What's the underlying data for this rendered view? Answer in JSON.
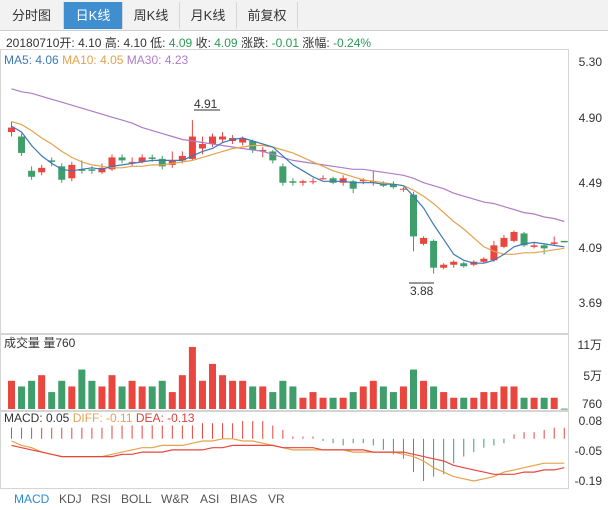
{
  "tabs": [
    {
      "label": "分时图",
      "active": false
    },
    {
      "label": "日K线",
      "active": true
    },
    {
      "label": "周K线",
      "active": false
    },
    {
      "label": "月K线",
      "active": false
    },
    {
      "label": "前复权",
      "active": false
    }
  ],
  "quote": {
    "date": "20180710",
    "open_label": "开:",
    "open": "4.10",
    "high_label": "高:",
    "high": "4.10",
    "low_label": "低:",
    "low": "4.09",
    "close_label": "收:",
    "close": "4.09",
    "change_label": "涨跌:",
    "change": "-0.01",
    "pct_label": "涨幅:",
    "pct": "-0.24%"
  },
  "ma": {
    "ma5_label": "MA5:",
    "ma5": "4.06",
    "ma10_label": "MA10:",
    "ma10": "4.05",
    "ma30_label": "MA30:",
    "ma30": "4.23"
  },
  "price_axis": [
    "5.30",
    "4.90",
    "4.49",
    "4.09",
    "3.69"
  ],
  "annotations": {
    "high": "4.91",
    "low": "3.88"
  },
  "volume": {
    "label": "成交量 量760",
    "axis": [
      "11万",
      "5万",
      "760"
    ]
  },
  "macd": {
    "macd_label": "MACD: 0.05",
    "diff_label": "DIFF: -0.11",
    "dea_label": "DEA: -0.13",
    "axis": [
      "0.08",
      "-0.05",
      "-0.19"
    ]
  },
  "indicator_tabs": [
    "MACD",
    "KDJ",
    "RSI",
    "BOLL",
    "W&R",
    "ASI",
    "BIAS",
    "VR"
  ],
  "colors": {
    "up": "#e8463e",
    "down": "#3f9e6a",
    "ma5": "#3e78b6",
    "ma10": "#e2a34c",
    "ma30": "#b07cc6",
    "active_tab": "#3e8ed0"
  },
  "chart_data": {
    "type": "candlestick",
    "ylim": [
      3.69,
      5.3
    ],
    "candles": [
      {
        "o": 4.83,
        "c": 4.86,
        "h": 4.9,
        "l": 4.8
      },
      {
        "o": 4.8,
        "c": 4.69,
        "h": 4.82,
        "l": 4.67
      },
      {
        "o": 4.57,
        "c": 4.53,
        "h": 4.6,
        "l": 4.51
      },
      {
        "o": 4.56,
        "c": 4.59,
        "h": 4.61,
        "l": 4.54
      },
      {
        "o": 4.64,
        "c": 4.63,
        "h": 4.66,
        "l": 4.6
      },
      {
        "o": 4.6,
        "c": 4.51,
        "h": 4.62,
        "l": 4.49
      },
      {
        "o": 4.52,
        "c": 4.61,
        "h": 4.63,
        "l": 4.5
      },
      {
        "o": 4.58,
        "c": 4.57,
        "h": 4.64,
        "l": 4.55
      },
      {
        "o": 4.58,
        "c": 4.57,
        "h": 4.6,
        "l": 4.55
      },
      {
        "o": 4.56,
        "c": 4.59,
        "h": 4.62,
        "l": 4.55
      },
      {
        "o": 4.58,
        "c": 4.66,
        "h": 4.68,
        "l": 4.57
      },
      {
        "o": 4.66,
        "c": 4.64,
        "h": 4.68,
        "l": 4.62
      },
      {
        "o": 4.63,
        "c": 4.63,
        "h": 4.66,
        "l": 4.6
      },
      {
        "o": 4.63,
        "c": 4.66,
        "h": 4.68,
        "l": 4.62
      },
      {
        "o": 4.66,
        "c": 4.65,
        "h": 4.68,
        "l": 4.63
      },
      {
        "o": 4.65,
        "c": 4.6,
        "h": 4.67,
        "l": 4.58
      },
      {
        "o": 4.61,
        "c": 4.64,
        "h": 4.7,
        "l": 4.59
      },
      {
        "o": 4.64,
        "c": 4.67,
        "h": 4.7,
        "l": 4.62
      },
      {
        "o": 4.65,
        "c": 4.8,
        "h": 4.91,
        "l": 4.64
      },
      {
        "o": 4.72,
        "c": 4.75,
        "h": 4.8,
        "l": 4.68
      },
      {
        "o": 4.75,
        "c": 4.8,
        "h": 4.82,
        "l": 4.73
      },
      {
        "o": 4.78,
        "c": 4.8,
        "h": 4.83,
        "l": 4.76
      },
      {
        "o": 4.77,
        "c": 4.79,
        "h": 4.81,
        "l": 4.75
      },
      {
        "o": 4.76,
        "c": 4.79,
        "h": 4.8,
        "l": 4.74
      },
      {
        "o": 4.77,
        "c": 4.71,
        "h": 4.78,
        "l": 4.69
      },
      {
        "o": 4.7,
        "c": 4.71,
        "h": 4.73,
        "l": 4.66
      },
      {
        "o": 4.7,
        "c": 4.64,
        "h": 4.71,
        "l": 4.62
      },
      {
        "o": 4.6,
        "c": 4.49,
        "h": 4.62,
        "l": 4.47
      },
      {
        "o": 4.5,
        "c": 4.49,
        "h": 4.52,
        "l": 4.47
      },
      {
        "o": 4.49,
        "c": 4.5,
        "h": 4.51,
        "l": 4.47
      },
      {
        "o": 4.5,
        "c": 4.5,
        "h": 4.52,
        "l": 4.48
      },
      {
        "o": 4.52,
        "c": 4.52,
        "h": 4.54,
        "l": 4.51
      },
      {
        "o": 4.52,
        "c": 4.49,
        "h": 4.53,
        "l": 4.48
      },
      {
        "o": 4.49,
        "c": 4.52,
        "h": 4.54,
        "l": 4.47
      },
      {
        "o": 4.5,
        "c": 4.45,
        "h": 4.51,
        "l": 4.42
      },
      {
        "o": 4.5,
        "c": 4.51,
        "h": 4.52,
        "l": 4.48
      },
      {
        "o": 4.5,
        "c": 4.5,
        "h": 4.57,
        "l": 4.47
      },
      {
        "o": 4.48,
        "c": 4.47,
        "h": 4.5,
        "l": 4.46
      },
      {
        "o": 4.48,
        "c": 4.46,
        "h": 4.5,
        "l": 4.45
      },
      {
        "o": 4.45,
        "c": 4.45,
        "h": 4.46,
        "l": 4.43
      },
      {
        "o": 4.41,
        "c": 4.13,
        "h": 4.43,
        "l": 4.03
      },
      {
        "o": 4.08,
        "c": 4.12,
        "h": 4.13,
        "l": 4.07
      },
      {
        "o": 4.1,
        "c": 3.92,
        "h": 4.11,
        "l": 3.88
      },
      {
        "o": 3.92,
        "c": 3.94,
        "h": 3.95,
        "l": 3.91
      },
      {
        "o": 3.94,
        "c": 3.96,
        "h": 3.97,
        "l": 3.92
      },
      {
        "o": 3.95,
        "c": 3.93,
        "h": 3.96,
        "l": 3.92
      },
      {
        "o": 3.94,
        "c": 3.96,
        "h": 3.97,
        "l": 3.93
      },
      {
        "o": 3.96,
        "c": 3.98,
        "h": 3.99,
        "l": 3.95
      },
      {
        "o": 3.97,
        "c": 4.07,
        "h": 4.1,
        "l": 3.96
      },
      {
        "o": 4.06,
        "c": 4.12,
        "h": 4.14,
        "l": 4.05
      },
      {
        "o": 4.1,
        "c": 4.16,
        "h": 4.17,
        "l": 4.09
      },
      {
        "o": 4.15,
        "c": 4.07,
        "h": 4.16,
        "l": 4.06
      },
      {
        "o": 4.06,
        "c": 4.07,
        "h": 4.09,
        "l": 4.05
      },
      {
        "o": 4.07,
        "c": 4.05,
        "h": 4.08,
        "l": 4.01
      },
      {
        "o": 4.08,
        "c": 4.09,
        "h": 4.13,
        "l": 4.07
      },
      {
        "o": 4.1,
        "c": 4.09,
        "h": 4.1,
        "l": 4.09
      }
    ],
    "ma5": [
      4.87,
      4.83,
      4.74,
      4.67,
      4.62,
      4.58,
      4.57,
      4.58,
      4.59,
      4.58,
      4.6,
      4.61,
      4.62,
      4.63,
      4.64,
      4.64,
      4.64,
      4.64,
      4.67,
      4.7,
      4.72,
      4.76,
      4.78,
      4.79,
      4.77,
      4.75,
      4.73,
      4.67,
      4.61,
      4.57,
      4.53,
      4.5,
      4.5,
      4.5,
      4.49,
      4.49,
      4.49,
      4.48,
      4.48,
      4.47,
      4.4,
      4.32,
      4.21,
      4.11,
      4.01,
      3.97,
      3.95,
      3.95,
      3.97,
      4.01,
      4.06,
      4.08,
      4.09,
      4.08,
      4.07,
      4.06
    ],
    "ma10": [
      4.9,
      4.88,
      4.84,
      4.79,
      4.75,
      4.7,
      4.66,
      4.63,
      4.61,
      4.6,
      4.59,
      4.59,
      4.6,
      4.6,
      4.61,
      4.61,
      4.62,
      4.63,
      4.64,
      4.66,
      4.68,
      4.7,
      4.72,
      4.73,
      4.74,
      4.74,
      4.73,
      4.71,
      4.69,
      4.66,
      4.63,
      4.6,
      4.57,
      4.55,
      4.53,
      4.51,
      4.5,
      4.49,
      4.48,
      4.47,
      4.44,
      4.4,
      4.35,
      4.29,
      4.23,
      4.18,
      4.12,
      4.06,
      4.03,
      4.01,
      4.01,
      4.02,
      4.02,
      4.03,
      4.04,
      4.05
    ],
    "ma30": [
      5.12,
      5.1,
      5.09,
      5.07,
      5.05,
      5.03,
      5.01,
      4.99,
      4.97,
      4.95,
      4.93,
      4.91,
      4.89,
      4.86,
      4.84,
      4.82,
      4.8,
      4.78,
      4.77,
      4.76,
      4.75,
      4.74,
      4.73,
      4.72,
      4.71,
      4.7,
      4.68,
      4.66,
      4.64,
      4.63,
      4.62,
      4.61,
      4.6,
      4.59,
      4.58,
      4.58,
      4.57,
      4.56,
      4.55,
      4.54,
      4.52,
      4.49,
      4.47,
      4.45,
      4.42,
      4.4,
      4.38,
      4.36,
      4.35,
      4.33,
      4.31,
      4.29,
      4.28,
      4.26,
      4.25,
      4.23
    ],
    "volume": [
      5,
      4,
      5,
      6,
      3,
      5,
      4,
      7,
      5,
      4,
      6,
      4,
      5,
      4,
      4,
      5,
      3,
      6,
      11,
      5,
      8,
      6,
      5,
      5,
      4,
      4,
      3,
      5,
      4,
      2,
      3,
      2,
      2,
      2,
      3,
      4,
      5,
      4,
      3,
      4,
      7,
      5,
      4,
      3,
      2,
      2,
      2,
      3,
      3,
      4,
      4,
      2,
      2,
      2,
      2,
      0.07
    ],
    "vol_ylim": [
      0,
      11
    ],
    "macd_bar": [
      0.05,
      0.05,
      0.05,
      0.05,
      0.05,
      0.05,
      0.05,
      0.05,
      0.05,
      0.05,
      0.06,
      0.06,
      0.06,
      0.06,
      0.06,
      0.06,
      0.06,
      0.06,
      0.06,
      0.07,
      0.07,
      0.07,
      0.07,
      0.08,
      0.08,
      0.08,
      0.06,
      0.04,
      0.01,
      0.01,
      0.01,
      -0.01,
      -0.02,
      -0.03,
      -0.02,
      -0.02,
      -0.03,
      -0.05,
      -0.07,
      -0.09,
      -0.15,
      -0.19,
      -0.17,
      -0.16,
      -0.11,
      -0.08,
      -0.06,
      -0.04,
      -0.03,
      -0.02,
      0.02,
      0.03,
      0.03,
      0.04,
      0.05,
      0.05
    ],
    "diff": [
      -0.01,
      -0.03,
      -0.04,
      -0.06,
      -0.07,
      -0.08,
      -0.08,
      -0.08,
      -0.08,
      -0.08,
      -0.07,
      -0.06,
      -0.05,
      -0.04,
      -0.04,
      -0.03,
      -0.03,
      -0.03,
      -0.02,
      -0.01,
      -0.01,
      0.0,
      0.0,
      -0.01,
      -0.01,
      -0.02,
      -0.03,
      -0.04,
      -0.05,
      -0.05,
      -0.05,
      -0.05,
      -0.05,
      -0.05,
      -0.06,
      -0.06,
      -0.06,
      -0.06,
      -0.06,
      -0.07,
      -0.08,
      -0.1,
      -0.13,
      -0.15,
      -0.17,
      -0.18,
      -0.19,
      -0.18,
      -0.17,
      -0.15,
      -0.14,
      -0.13,
      -0.12,
      -0.11,
      -0.11,
      -0.11
    ],
    "dea": [
      -0.03,
      -0.04,
      -0.05,
      -0.06,
      -0.07,
      -0.08,
      -0.08,
      -0.08,
      -0.08,
      -0.08,
      -0.08,
      -0.07,
      -0.07,
      -0.06,
      -0.06,
      -0.06,
      -0.05,
      -0.05,
      -0.05,
      -0.05,
      -0.04,
      -0.04,
      -0.03,
      -0.03,
      -0.03,
      -0.03,
      -0.03,
      -0.04,
      -0.04,
      -0.04,
      -0.04,
      -0.05,
      -0.05,
      -0.05,
      -0.05,
      -0.05,
      -0.06,
      -0.06,
      -0.06,
      -0.06,
      -0.07,
      -0.08,
      -0.09,
      -0.1,
      -0.12,
      -0.13,
      -0.14,
      -0.15,
      -0.16,
      -0.16,
      -0.16,
      -0.15,
      -0.15,
      -0.14,
      -0.14,
      -0.13
    ],
    "macd_ylim": [
      -0.19,
      0.08
    ]
  }
}
